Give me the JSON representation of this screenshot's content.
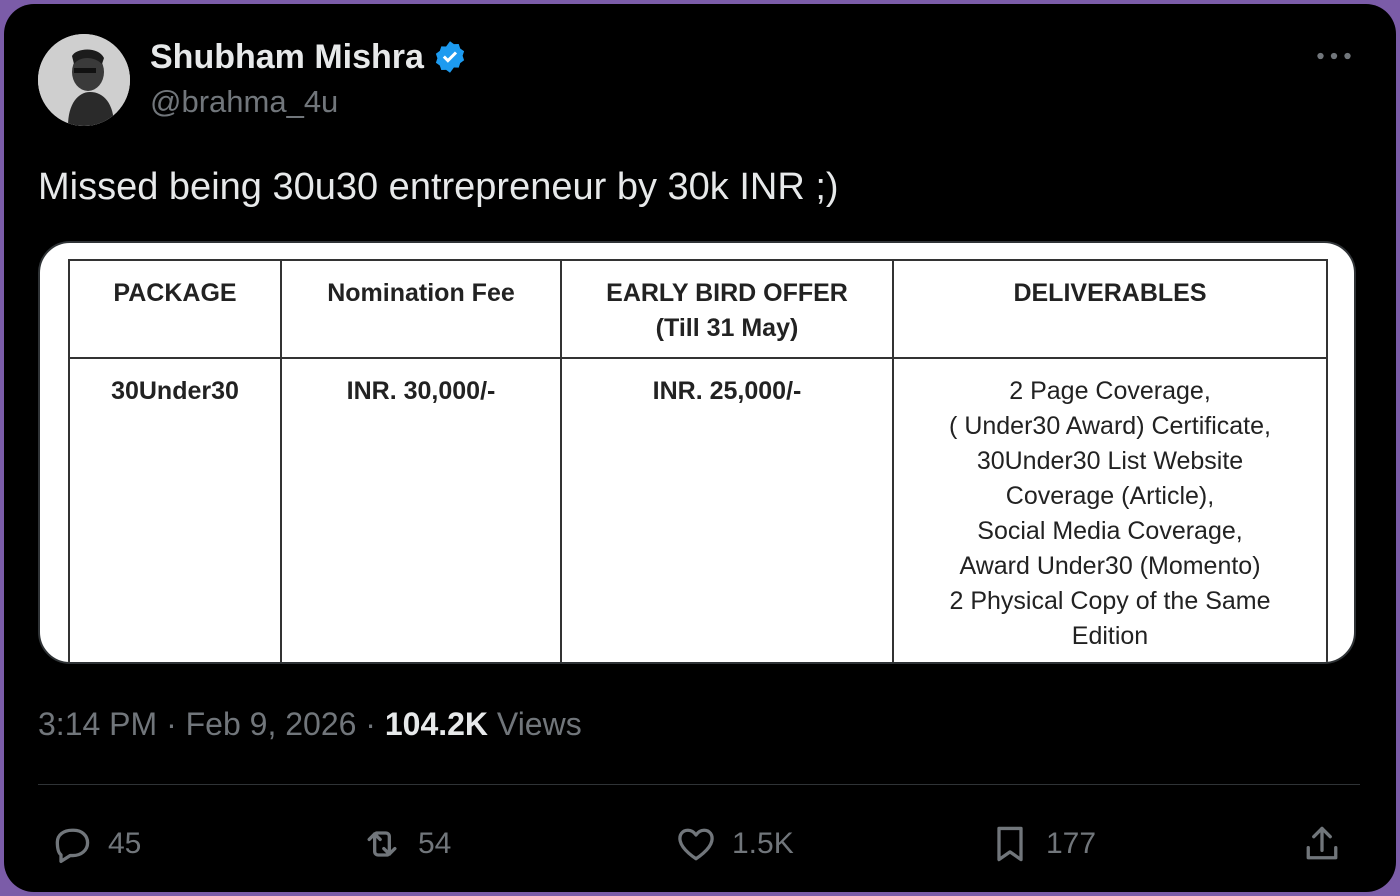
{
  "author": {
    "name": "Shubham Mishra",
    "handle": "@brahma_4u",
    "verified_color": "#1d9bf0"
  },
  "icons": {
    "more": "more-dots-icon",
    "verified": "verified-badge-icon",
    "reply": "reply-icon",
    "repost": "repost-icon",
    "like": "heart-icon",
    "bookmark": "bookmark-icon",
    "share": "share-icon"
  },
  "tweet": {
    "text": "Missed being 30u30 entrepreneur by 30k INR ;)"
  },
  "media": {
    "headers": {
      "package": "PACKAGE",
      "fee": "Nomination Fee",
      "early_line1": "EARLY BIRD OFFER",
      "early_line2": "(Till 31 May)",
      "deliverables": "DELIVERABLES"
    },
    "row": {
      "package": "30Under30",
      "fee": "INR. 30,000/-",
      "early": "INR. 25,000/-",
      "deliverables": [
        "2 Page Coverage,",
        "( Under30 Award) Certificate,",
        "30Under30 List Website",
        "Coverage (Article),",
        "Social Media Coverage,",
        "Award  Under30 (Momento)",
        "2 Physical Copy of the Same",
        "Edition"
      ]
    }
  },
  "meta": {
    "time": "3:14 PM",
    "sep1": " · ",
    "date": "Feb 9, 2026",
    "sep2": " · ",
    "views_count": "104.2K",
    "views_label": "Views"
  },
  "actions": {
    "replies": "45",
    "reposts": "54",
    "likes": "1.5K",
    "bookmarks": "177"
  },
  "colors": {
    "background": "#000000",
    "frame": "#7b5ca8",
    "text_primary": "#e7e9ea",
    "text_secondary": "#71767b"
  }
}
